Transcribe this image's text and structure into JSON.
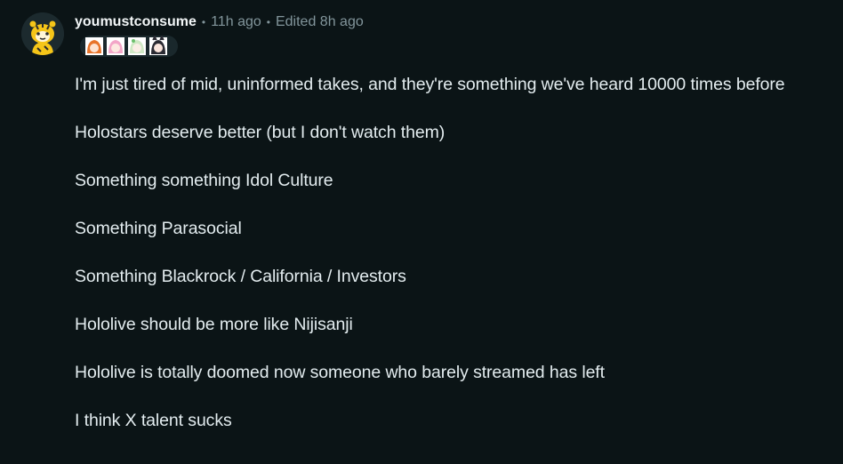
{
  "comment": {
    "username": "youmustconsume",
    "separator": "•",
    "posted_time": "11h ago",
    "edited_time": "Edited 8h ago",
    "avatar_icon": "snoo-avatar-icon",
    "flair_icon": "flair-emojis-icon",
    "paragraphs": [
      "I'm just tired of mid, uninformed takes, and they're something we've heard 10000 times before",
      "Holostars deserve better (but I don't watch them)",
      "Something something Idol Culture",
      "Something Parasocial",
      "Something Blackrock / California / Investors",
      "Hololive should be more like Nijisanji",
      "Hololive is totally doomed now someone who barely streamed has left",
      "I think X talent sucks"
    ]
  },
  "colors": {
    "background": "#0b1416",
    "text": "#e3ecef",
    "meta": "#82959b",
    "avatar_yellow": "#f5c518"
  }
}
